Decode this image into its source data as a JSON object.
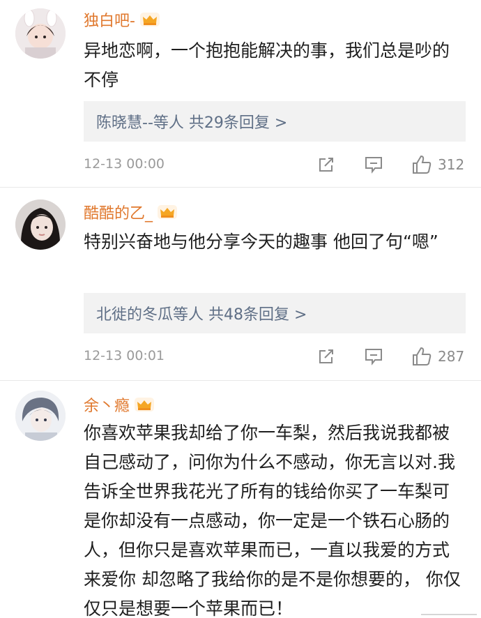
{
  "comments": [
    {
      "username": "独白吧-",
      "text": "异地恋啊，一个抱抱能解决的事，我们总是吵的不停",
      "reply_summary": "陈晓慧--等人  共29条回复 >",
      "timestamp": "12-13 00:00",
      "likes": "312"
    },
    {
      "username": "酷酷的乙_",
      "text": "特别兴奋地与他分享今天的趣事 他回了句“嗯”",
      "reply_summary": "北徙的冬瓜等人  共48条回复 >",
      "timestamp": "12-13 00:01",
      "likes": "287"
    },
    {
      "username": "余丶瘾",
      "text": "你喜欢苹果我却给了你一车梨，然后我说我都被自己感动了，问你为什么不感动，你无言以对.我告诉全世界我花光了所有的钱给你买了一车梨可是你却没有一点感动，你一定是一个铁石心肠的人，但你只是喜欢苹果而已，一直以我爱的方式来爱你 却忽略了我给你的是不是你想要的， 你仅仅只是想要一个苹果而已！"
    }
  ],
  "icons": {
    "badge": "crown-icon",
    "share": "share-icon",
    "comment": "comment-icon",
    "like": "thumbs-up-icon"
  },
  "colors": {
    "username": "#e0782d",
    "reply_link": "#5f6f86",
    "reply_bg": "#f2f2f2",
    "crown": "#f5a623"
  }
}
